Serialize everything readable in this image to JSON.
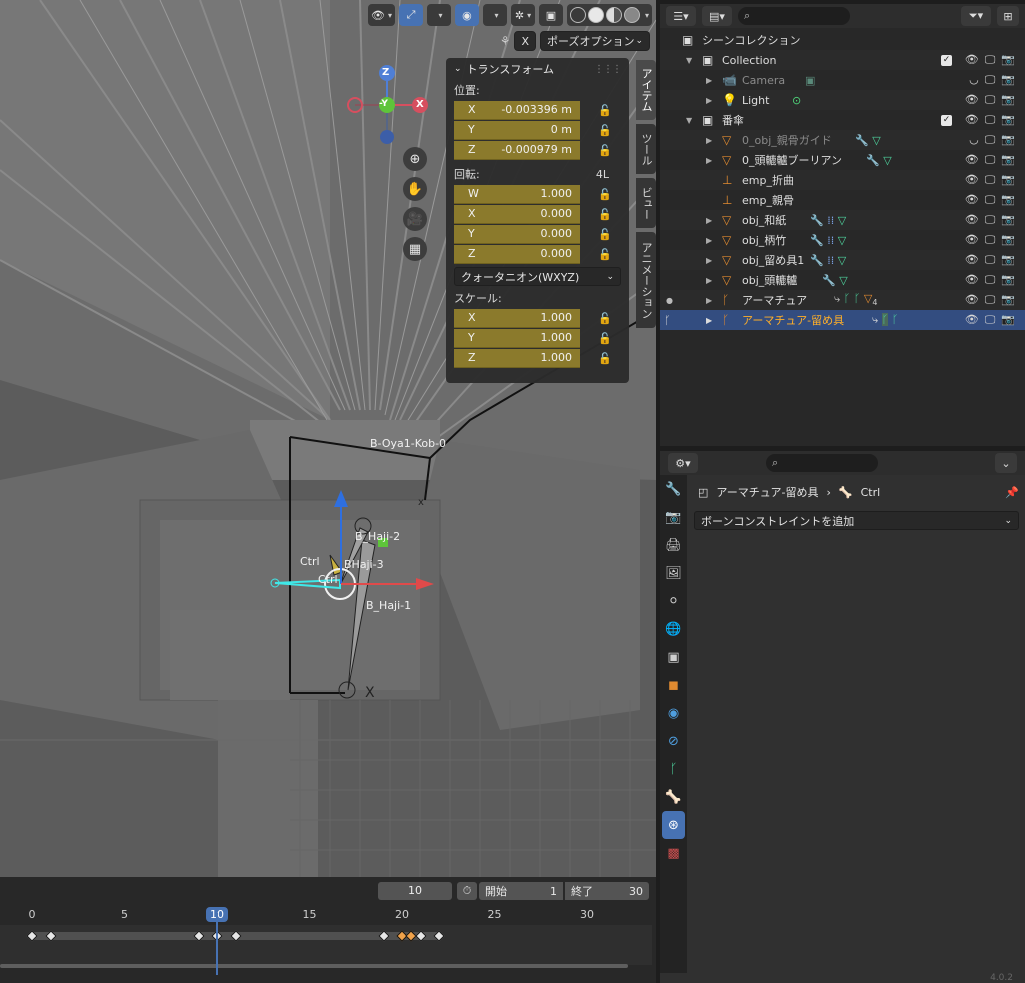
{
  "viewport": {
    "pose_toggle": "X",
    "pose_options": "ポーズオプション",
    "gizmo": {
      "z": "Z",
      "y": "-Y",
      "x": "X"
    },
    "bones": {
      "oya": "B-Oya1-Kob-0",
      "haji2": "B_Haji-2",
      "ctrl1": "Ctrl",
      "haji3": "BHaji-3",
      "ctrl2": "Ctrl",
      "haji1": "B_Haji-1"
    },
    "side_tabs": [
      "アイテム",
      "ツール",
      "ビュー",
      "アニメーション"
    ]
  },
  "transform": {
    "title": "トランスフォーム",
    "location_label": "位置:",
    "location": [
      {
        "axis": "X",
        "value": "-0.003396 m"
      },
      {
        "axis": "Y",
        "value": "0 m"
      },
      {
        "axis": "Z",
        "value": "-0.000979 m"
      }
    ],
    "rotation_label": "回転:",
    "rotation_extra": "4L",
    "rotation": [
      {
        "axis": "W",
        "value": "1.000"
      },
      {
        "axis": "X",
        "value": "0.000"
      },
      {
        "axis": "Y",
        "value": "0.000"
      },
      {
        "axis": "Z",
        "value": "0.000"
      }
    ],
    "rotation_mode": "クォータニオン(WXYZ)",
    "scale_label": "スケール:",
    "scale": [
      {
        "axis": "X",
        "value": "1.000"
      },
      {
        "axis": "Y",
        "value": "1.000"
      },
      {
        "axis": "Z",
        "value": "1.000"
      }
    ]
  },
  "timeline": {
    "current_frame": "10",
    "start_label": "開始",
    "start": "1",
    "end_label": "終了",
    "end": "30",
    "ticks": [
      "0",
      "5",
      "10",
      "15",
      "20",
      "25",
      "30"
    ],
    "keyframes": [
      0,
      1,
      9,
      10,
      11,
      19,
      20,
      20.5,
      21,
      22
    ]
  },
  "outliner": {
    "rows": [
      {
        "name": "シーンコレクション"
      },
      {
        "name": "Collection"
      },
      {
        "name": "Camera"
      },
      {
        "name": "Light"
      },
      {
        "name": "番傘"
      },
      {
        "name": "0_obj_親骨ガイド"
      },
      {
        "name": "0_頭轆轤ブーリアン"
      },
      {
        "name": "emp_折曲"
      },
      {
        "name": "emp_親骨"
      },
      {
        "name": "obj_和紙"
      },
      {
        "name": "obj_柄竹"
      },
      {
        "name": "obj_留め具1"
      },
      {
        "name": "obj_頭轆轤"
      },
      {
        "name": "アーマチュア",
        "badge": "4"
      },
      {
        "name": "アーマチュア-留め具"
      }
    ]
  },
  "properties": {
    "breadcrumb_object": "アーマチュア-留め具",
    "breadcrumb_bone": "Ctrl",
    "add_constraint": "ボーンコンストレイントを追加",
    "version": "4.0.2"
  }
}
